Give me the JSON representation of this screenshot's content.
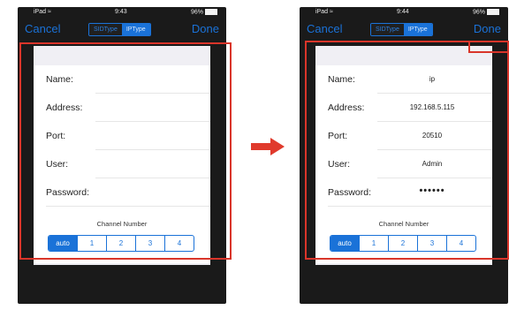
{
  "status_left": {
    "carrier": "iPad",
    "time": "9:43",
    "battery": "96%"
  },
  "status_right": {
    "carrier": "iPad",
    "time": "9:44",
    "battery": "96%"
  },
  "nav": {
    "cancel_label": "Cancel",
    "done_label": "Done",
    "segments": [
      "SIDType",
      "IPType"
    ],
    "active_segment": "IPType"
  },
  "form": {
    "fields": [
      {
        "label": "Name:"
      },
      {
        "label": "Address:"
      },
      {
        "label": "Port:"
      },
      {
        "label": "User:"
      },
      {
        "label": "Password:"
      }
    ],
    "channel_title": "Channel Number",
    "channels": [
      "auto",
      "1",
      "2",
      "3",
      "4"
    ],
    "active_channel": "auto"
  },
  "values_right": {
    "name": "ip",
    "address": "192.168.5.115",
    "port": "20510",
    "user": "Admin",
    "password": "••••••"
  },
  "colors": {
    "ios_blue": "#1a72d8",
    "highlight_red": "#d9352a",
    "arrow_red": "#e03a2c",
    "bezel": "#1a1a1a",
    "grouped_bg": "#f0eff4"
  },
  "icons": {
    "arrow": "right-arrow-icon",
    "wifi": "wifi-icon",
    "battery": "battery-icon"
  }
}
